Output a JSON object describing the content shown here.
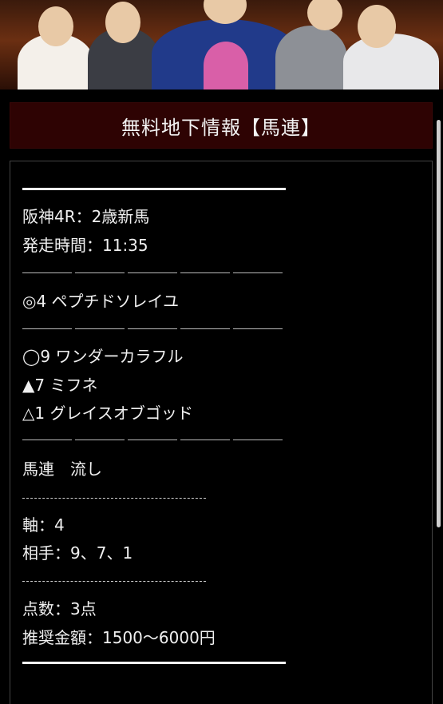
{
  "header": {
    "title": "無料地下情報【馬連】"
  },
  "race": {
    "name": "阪神4R：2歳新馬",
    "start_time": "発走時間：11:35"
  },
  "picks": {
    "main": "◎4 ペプチドソレイユ",
    "second": "◯9 ワンダーカラフル",
    "third": "▲7 ミフネ",
    "fourth": "△1 グレイスオブゴッド"
  },
  "bet": {
    "type": "馬連　流し",
    "axis": "軸：4",
    "partners": "相手：9、7、1",
    "points": "点数：3点",
    "amount": "推奨金額：1500〜6000円"
  }
}
